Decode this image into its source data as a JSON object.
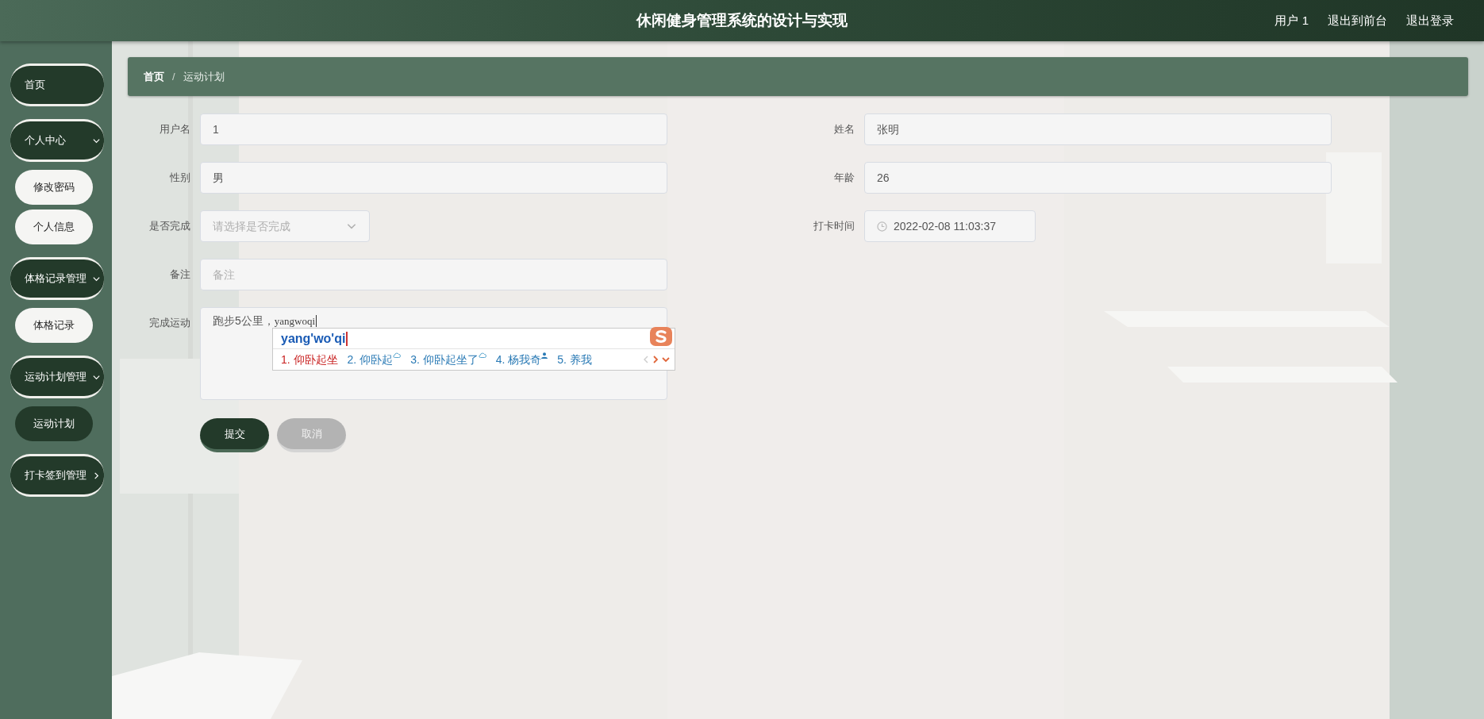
{
  "header": {
    "title": "休闲健身管理系统的设计与实现",
    "links": [
      "用户 1",
      "退出到前台",
      "退出登录"
    ]
  },
  "sidebar": [
    {
      "label": "首页"
    },
    {
      "label": "个人中心",
      "expanded": true,
      "children": [
        {
          "label": "修改密码",
          "selected": false
        },
        {
          "label": "个人信息",
          "selected": false
        }
      ]
    },
    {
      "label": "体格记录管理",
      "expanded": true,
      "children": [
        {
          "label": "体格记录",
          "selected": false
        }
      ]
    },
    {
      "label": "运动计划管理",
      "expanded": true,
      "children": [
        {
          "label": "运动计划",
          "selected": true
        }
      ]
    },
    {
      "label": "打卡签到管理",
      "expanded": false
    }
  ],
  "breadcrumb": {
    "separator": "/",
    "items": [
      "首页",
      "运动计划"
    ]
  },
  "form": {
    "rows": [
      [
        {
          "label": "用户名",
          "kind": "text",
          "value": "1"
        },
        {
          "label": "姓名",
          "kind": "text",
          "value": "张明"
        }
      ],
      [
        {
          "label": "性别",
          "kind": "text",
          "value": "男"
        },
        {
          "label": "年龄",
          "kind": "text",
          "value": "26"
        }
      ],
      [
        {
          "label": "是否完成",
          "kind": "select",
          "placeholder": "请选择是否完成"
        },
        {
          "label": "打卡时间",
          "kind": "date",
          "value": "2022-02-08 11:03:37"
        }
      ],
      [
        {
          "label": "备注",
          "kind": "text",
          "placeholder": "备注"
        }
      ],
      [
        {
          "label": "完成运动",
          "kind": "textarea",
          "value": "跑步5公里，",
          "composing": "yangwoqi"
        }
      ]
    ],
    "buttons": [
      {
        "label": "提交",
        "kind": "primary"
      },
      {
        "label": "取消",
        "kind": "secondary"
      }
    ]
  },
  "ime": {
    "composition": "yang'wo'qi",
    "candidates": [
      {
        "label": "1. 仰卧起坐",
        "selected": true,
        "kind": "plain"
      },
      {
        "label": "2. 仰卧起",
        "selected": false,
        "kind": "cloud"
      },
      {
        "label": "3. 仰卧起坐了",
        "selected": false,
        "kind": "cloud"
      },
      {
        "label": "4. 杨我奇",
        "selected": false,
        "kind": "person"
      },
      {
        "label": "5. 养我",
        "selected": false,
        "kind": "plain"
      }
    ]
  }
}
